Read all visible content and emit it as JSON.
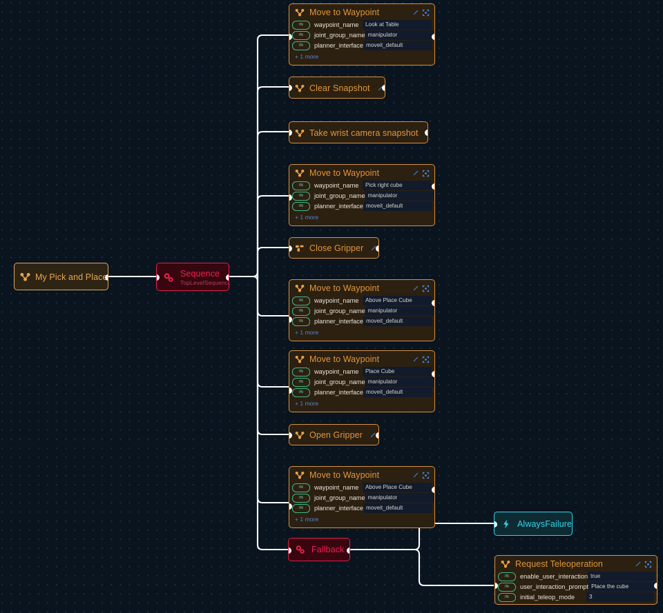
{
  "canvas": {
    "background_color": "#0a141f",
    "grid_dot_color": "#96afc8",
    "edge_color": "#ffffff"
  },
  "colors": {
    "action_border": "#d79240",
    "action_fill": "#2c2011",
    "action_title": "#e0963c",
    "control_border": "#e01f4a",
    "control_fill": "#37060f",
    "control_title": "#f0214f",
    "decorator_border": "#2fd4e8",
    "decorator_fill": "#0e2a33",
    "decorator_title": "#35d6ea",
    "port_pin_border": "#3fb98c",
    "value_field_bg": "#121b2c",
    "more_link": "#4f86d8",
    "tool_icon": "#3d8bf2"
  },
  "labels": {
    "pin_in": "IN",
    "more_suffix": "+ 1 more"
  },
  "nodes": [
    {
      "id": "root",
      "kind": "root",
      "title": "My Pick and Place",
      "icon": "behavior-tree-icon"
    },
    {
      "id": "sequence",
      "kind": "control",
      "title": "Sequence",
      "subtitle": "TopLevelSequence",
      "icon": "gears-icon"
    },
    {
      "id": "move-look-at-table",
      "kind": "action",
      "title": "Move to Waypoint",
      "icon": "behavior-tree-icon",
      "more": "+ 1 more",
      "fields": [
        {
          "pin": "IN",
          "name": "waypoint_name",
          "value": "Look at Table"
        },
        {
          "pin": "IN",
          "name": "joint_group_name",
          "value": "manipulator"
        },
        {
          "pin": "IN",
          "name": "planner_interface",
          "value": "moveit_default"
        }
      ]
    },
    {
      "id": "clear-snapshot",
      "kind": "action",
      "title": "Clear Snapshot",
      "icon": "behavior-tree-icon",
      "fields": []
    },
    {
      "id": "take-wrist-camera-snapshot",
      "kind": "action",
      "title": "Take wrist camera snapshot",
      "icon": "behavior-tree-icon",
      "fields": []
    },
    {
      "id": "move-pick-right-cube",
      "kind": "action",
      "title": "Move to Waypoint",
      "icon": "behavior-tree-icon",
      "more": "+ 1 more",
      "fields": [
        {
          "pin": "IN",
          "name": "waypoint_name",
          "value": "Pick right cube"
        },
        {
          "pin": "IN",
          "name": "joint_group_name",
          "value": "manipulator"
        },
        {
          "pin": "IN",
          "name": "planner_interface",
          "value": "moveit_default"
        }
      ]
    },
    {
      "id": "close-gripper",
      "kind": "action",
      "title": "Close Gripper",
      "icon": "gripper-icon",
      "fields": []
    },
    {
      "id": "move-above-place-cube-1",
      "kind": "action",
      "title": "Move to Waypoint",
      "icon": "behavior-tree-icon",
      "more": "+ 1 more",
      "fields": [
        {
          "pin": "IN",
          "name": "waypoint_name",
          "value": "Above Place Cube"
        },
        {
          "pin": "IN",
          "name": "joint_group_name",
          "value": "manipulator"
        },
        {
          "pin": "IN",
          "name": "planner_interface",
          "value": "moveit_default"
        }
      ]
    },
    {
      "id": "move-place-cube",
      "kind": "action",
      "title": "Move to Waypoint",
      "icon": "behavior-tree-icon",
      "more": "+ 1 more",
      "fields": [
        {
          "pin": "IN",
          "name": "waypoint_name",
          "value": "Place Cube"
        },
        {
          "pin": "IN",
          "name": "joint_group_name",
          "value": "manipulator"
        },
        {
          "pin": "IN",
          "name": "planner_interface",
          "value": "moveit_default"
        }
      ]
    },
    {
      "id": "open-gripper",
      "kind": "action",
      "title": "Open Gripper",
      "icon": "behavior-tree-icon",
      "fields": []
    },
    {
      "id": "move-above-place-cube-2",
      "kind": "action",
      "title": "Move to Waypoint",
      "icon": "behavior-tree-icon",
      "more": "+ 1 more",
      "fields": [
        {
          "pin": "IN",
          "name": "waypoint_name",
          "value": "Above Place Cube"
        },
        {
          "pin": "IN",
          "name": "joint_group_name",
          "value": "manipulator"
        },
        {
          "pin": "IN",
          "name": "planner_interface",
          "value": "moveit_default"
        }
      ]
    },
    {
      "id": "fallback",
      "kind": "control",
      "title": "Fallback",
      "icon": "gears-icon"
    },
    {
      "id": "always-failure",
      "kind": "decorator",
      "title": "AlwaysFailure",
      "icon": "lightning-bolt-icon"
    },
    {
      "id": "request-teleoperation",
      "kind": "action",
      "title": "Request Teleoperation",
      "icon": "behavior-tree-icon",
      "fields": [
        {
          "pin": "IN",
          "name": "enable_user_interaction",
          "value": "true"
        },
        {
          "pin": "IN",
          "name": "user_interaction_prompt",
          "value": "Place the cube"
        },
        {
          "pin": "IN",
          "name": "initial_teleop_mode",
          "value": "3"
        }
      ]
    }
  ]
}
